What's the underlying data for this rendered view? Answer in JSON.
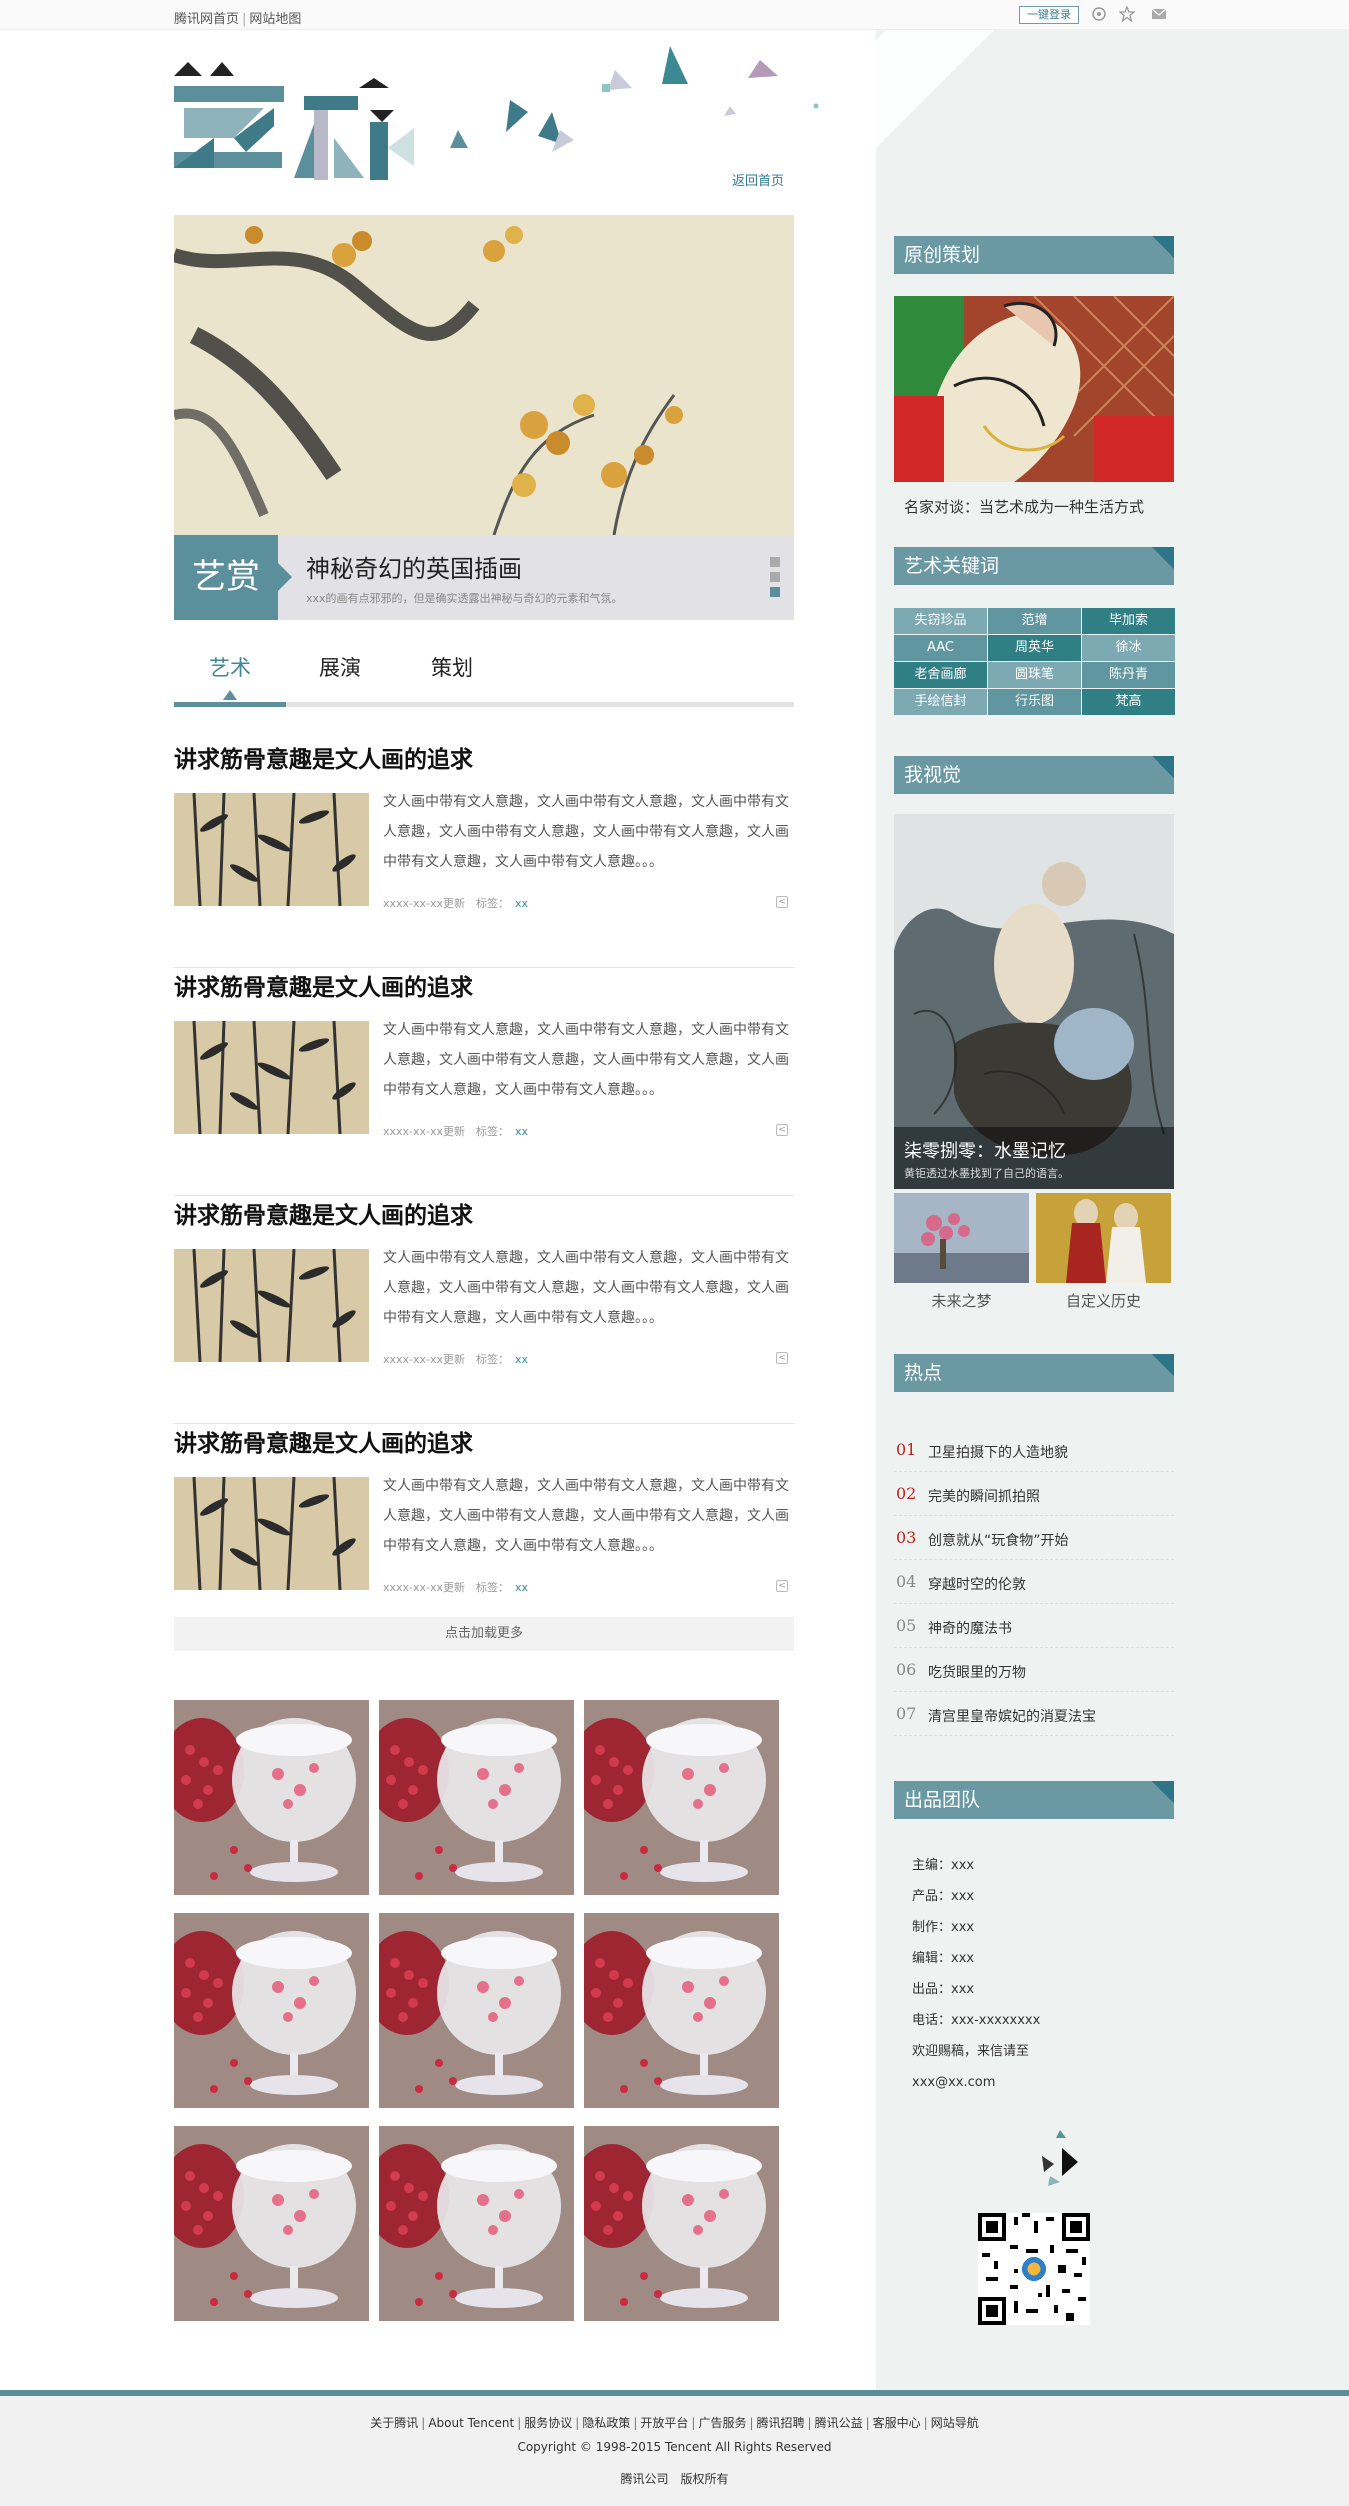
{
  "topbar": {
    "home": "腾讯网首页",
    "sitemap": "网站地图",
    "login": "一键登录",
    "icons": [
      "weibo-icon",
      "star-icon",
      "mail-icon"
    ]
  },
  "header": {
    "logo_text": "艺术",
    "home_link": "返回首页"
  },
  "hero": {
    "tag": "艺赏",
    "title": "神秘奇幻的英国插画",
    "subtitle": "xxx的画有点邪邪的，但是确实透露出神秘与奇幻的元素和气氛。"
  },
  "tabs": [
    "艺术",
    "展演",
    "策划"
  ],
  "articles": [
    {
      "title": "讲求筋骨意趣是文人画的追求",
      "text": "文人画中带有文人意趣，文人画中带有文人意趣，文人画中带有文人意趣，文人画中带有文人意趣，文人画中带有文人意趣，文人画中带有文人意趣，文人画中带有文人意趣。。。",
      "date": "xxxx-xx-xx更新",
      "tag_label": "标签：",
      "tag": "xx"
    },
    {
      "title": "讲求筋骨意趣是文人画的追求",
      "text": "文人画中带有文人意趣，文人画中带有文人意趣，文人画中带有文人意趣，文人画中带有文人意趣，文人画中带有文人意趣，文人画中带有文人意趣，文人画中带有文人意趣。。。",
      "date": "xxxx-xx-xx更新",
      "tag_label": "标签：",
      "tag": "xx"
    },
    {
      "title": "讲求筋骨意趣是文人画的追求",
      "text": "文人画中带有文人意趣，文人画中带有文人意趣，文人画中带有文人意趣，文人画中带有文人意趣，文人画中带有文人意趣，文人画中带有文人意趣，文人画中带有文人意趣。。。",
      "date": "xxxx-xx-xx更新",
      "tag_label": "标签：",
      "tag": "xx"
    },
    {
      "title": "讲求筋骨意趣是文人画的追求",
      "text": "文人画中带有文人意趣，文人画中带有文人意趣，文人画中带有文人意趣，文人画中带有文人意趣，文人画中带有文人意趣，文人画中带有文人意趣，文人画中带有文人意趣。。。",
      "date": "xxxx-xx-xx更新",
      "tag_label": "标签：",
      "tag": "xx"
    }
  ],
  "load_more": "点击加载更多",
  "sidebar": {
    "plan_title": "原创策划",
    "plan_caption": "名家对谈：当艺术成为一种生活方式",
    "keywords_title": "艺术关键词",
    "keywords": [
      "失窃珍品",
      "范增",
      "毕加索",
      "AAC",
      "周英华",
      "徐冰",
      "老舍画廊",
      "圆珠笔",
      "陈丹青",
      "手绘信封",
      "行乐图",
      "梵高"
    ],
    "vision_title": "我视觉",
    "vision_caption": "柒零捌零：水墨记忆",
    "vision_sub": "黄钜透过水墨找到了自己的语言。",
    "small1": "未来之梦",
    "small2": "自定义历史",
    "hot_title": "热点",
    "hot": [
      {
        "n": "01",
        "t": "卫星拍摄下的人造地貌"
      },
      {
        "n": "02",
        "t": "完美的瞬间抓拍照"
      },
      {
        "n": "03",
        "t": "创意就从“玩食物”开始"
      },
      {
        "n": "04",
        "t": "穿越时空的伦敦"
      },
      {
        "n": "05",
        "t": "神奇的魔法书"
      },
      {
        "n": "06",
        "t": "吃货眼里的万物"
      },
      {
        "n": "07",
        "t": "清宫里皇帝嫔妃的消夏法宝"
      }
    ],
    "team_title": "出品团队",
    "team": [
      "主编：xxx",
      "产品：xxx",
      "制作：xxx",
      "编辑：xxx",
      "出品：xxx",
      "电话：xxx-xxxxxxxx",
      "欢迎赐稿，来信请至",
      "xxx@xx.com"
    ]
  },
  "footer": {
    "links": [
      "关于腾讯",
      "About Tencent",
      "服务协议",
      "隐私政策",
      "开放平台",
      "广告服务",
      "腾讯招聘",
      "腾讯公益",
      "客服中心",
      "网站导航"
    ],
    "copyright": "Copyright © 1998-2015 Tencent All Rights Reserved",
    "company": "腾讯公司　版权所有"
  },
  "colors": {
    "accent": "#5b8f9b",
    "accent_dark": "#2e7587",
    "hot_red": "#c41f1f",
    "side_bg": "#eef3f2"
  }
}
